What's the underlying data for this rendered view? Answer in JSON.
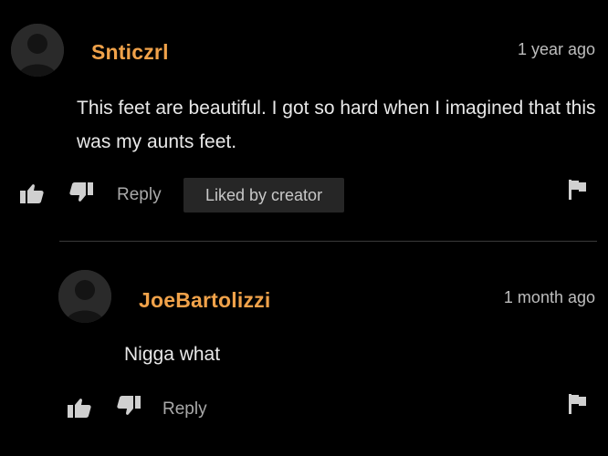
{
  "comments": [
    {
      "username": "Snticzrl",
      "timestamp": "1 year ago",
      "text": "This feet are beautiful. I got so hard when I imagined that this was my aunts feet.",
      "reply_label": "Reply",
      "badge": "Liked by creator",
      "icons": [
        "avatar-placeholder-icon",
        "thumbs-up-icon",
        "thumbs-down-icon",
        "flag-icon"
      ]
    },
    {
      "username": "JoeBartolizzi",
      "timestamp": "1 month ago",
      "text": "Nigga what",
      "reply_label": "Reply",
      "icons": [
        "avatar-placeholder-icon",
        "thumbs-up-icon",
        "thumbs-down-icon",
        "flag-icon"
      ]
    }
  ],
  "colors": {
    "background": "#000000",
    "username": "#f0a24a",
    "text": "#e8e8e8",
    "muted": "#a9a9a9",
    "badge_bg": "#262626"
  }
}
